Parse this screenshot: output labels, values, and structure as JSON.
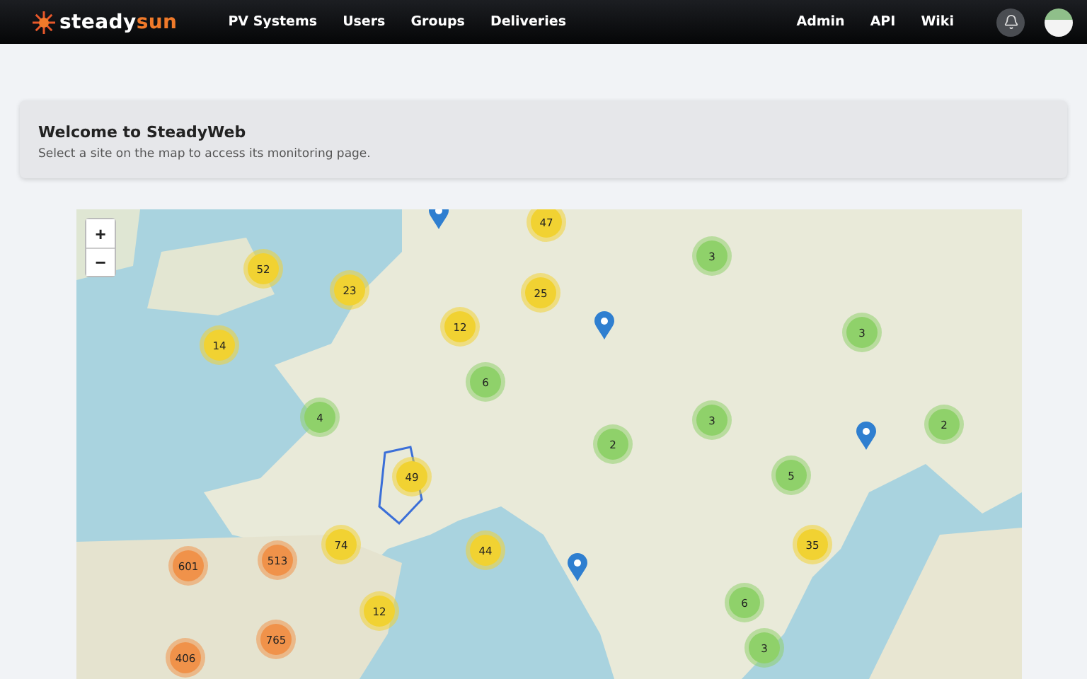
{
  "navbar": {
    "logo": {
      "first": "steady",
      "second": "sun"
    },
    "links": [
      {
        "label": "PV Systems"
      },
      {
        "label": "Users"
      },
      {
        "label": "Groups"
      },
      {
        "label": "Deliveries"
      }
    ],
    "right_links": [
      {
        "label": "Admin"
      },
      {
        "label": "API"
      },
      {
        "label": "Wiki"
      }
    ]
  },
  "welcome": {
    "title": "Welcome to SteadyWeb",
    "subtitle": "Select a site on the map to access its monitoring page."
  },
  "map": {
    "zoom_in": "+",
    "zoom_out": "−",
    "clusters": [
      {
        "count": "47",
        "color": "#f1d232"
      },
      {
        "count": "52",
        "color": "#f1d232"
      },
      {
        "count": "3",
        "color": "#8fd16a"
      },
      {
        "count": "23",
        "color": "#f1d232"
      },
      {
        "count": "25",
        "color": "#f1d232"
      },
      {
        "count": "12",
        "color": "#f1d232"
      },
      {
        "count": "14",
        "color": "#f1d232"
      },
      {
        "count": "3",
        "color": "#8fd16a"
      },
      {
        "count": "6",
        "color": "#8fd16a"
      },
      {
        "count": "4",
        "color": "#8fd16a"
      },
      {
        "count": "3",
        "color": "#8fd16a"
      },
      {
        "count": "2",
        "color": "#8fd16a"
      },
      {
        "count": "2",
        "color": "#8fd16a"
      },
      {
        "count": "49",
        "color": "#f1d232"
      },
      {
        "count": "5",
        "color": "#8fd16a"
      },
      {
        "count": "74",
        "color": "#f1d232"
      },
      {
        "count": "44",
        "color": "#f1d232"
      },
      {
        "count": "35",
        "color": "#f1d232"
      },
      {
        "count": "601",
        "color": "#f0924a"
      },
      {
        "count": "513",
        "color": "#f0924a"
      },
      {
        "count": "12",
        "color": "#f1d232"
      },
      {
        "count": "6",
        "color": "#8fd16a"
      },
      {
        "count": "765",
        "color": "#f0924a"
      },
      {
        "count": "3",
        "color": "#8fd16a"
      },
      {
        "count": "406",
        "color": "#f0924a"
      }
    ]
  }
}
